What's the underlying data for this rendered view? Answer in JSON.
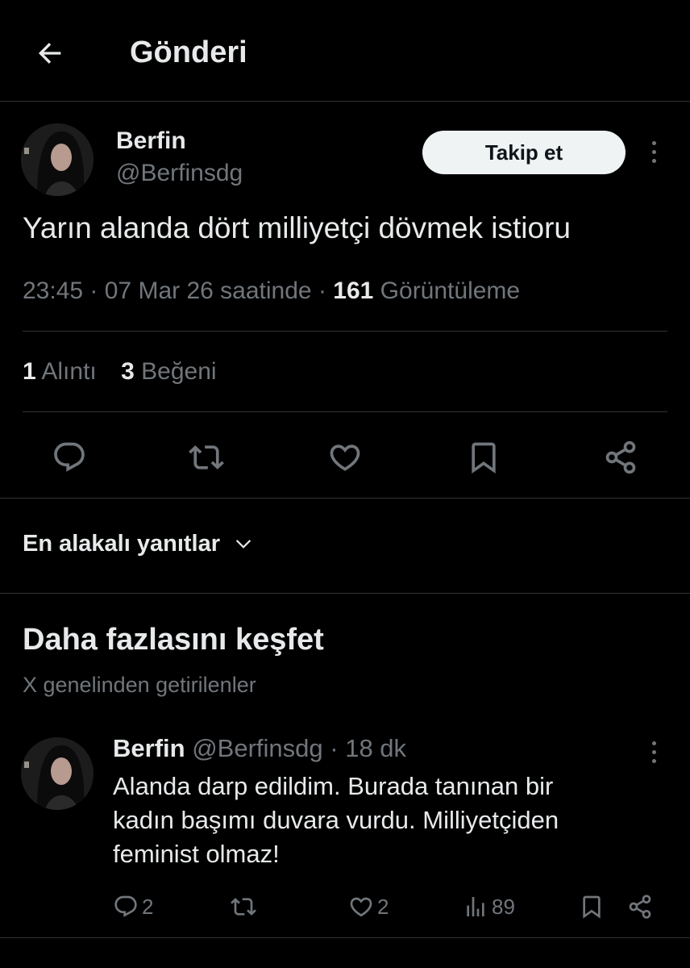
{
  "header": {
    "title": "Gönderi",
    "back_icon": "arrow-left-icon"
  },
  "tweet": {
    "author_name": "Berfin",
    "author_handle": "@Berfinsdg",
    "follow_label": "Takip et",
    "text": "Yarın alanda dört milliyetçi dövmek istioru",
    "time": "23:45",
    "date": "07 Mar 26 saatinde",
    "views_count": "161",
    "views_label": "Görüntüleme",
    "quotes_count": "1",
    "quotes_label": "Alıntı",
    "likes_count": "3",
    "likes_label": "Beğeni",
    "actions": [
      "reply-icon",
      "retweet-icon",
      "like-icon",
      "bookmark-icon",
      "share-icon"
    ]
  },
  "replies_sort": {
    "label": "En alakalı yanıtlar"
  },
  "discover": {
    "title": "Daha fazlasını keşfet",
    "subtitle": "X genelinden getirilenler",
    "post": {
      "author_name": "Berfin",
      "author_handle": "@Berfinsdg",
      "time_ago": "18 dk",
      "lines": [
        "Alanda darp edildim. Burada tanınan bir",
        "kadın başımı duvara vurdu. Milliyetçiden",
        "feminist olmaz!"
      ],
      "reply_count": "2",
      "like_count": "2",
      "view_count": "89"
    }
  },
  "colors": {
    "background": "#000000",
    "text": "#e7e9ea",
    "muted": "#71767b",
    "divider": "#2f3336",
    "button_bg": "#eff3f4"
  }
}
